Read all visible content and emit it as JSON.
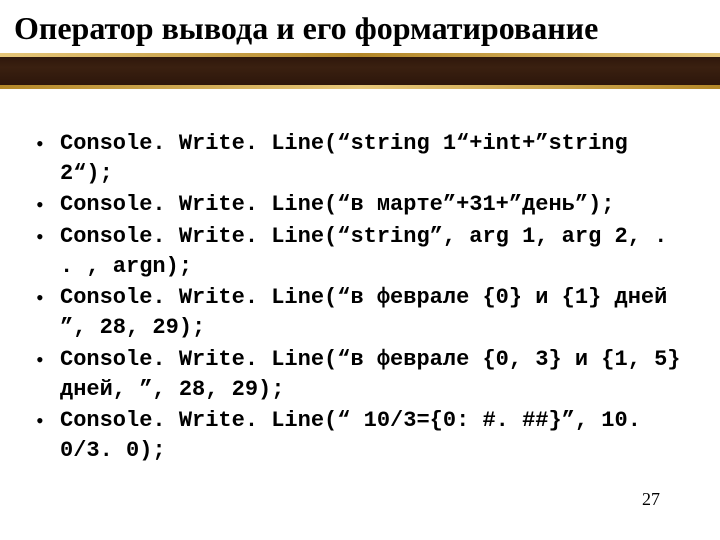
{
  "title": "Оператор вывода и его форматирование",
  "bullets": [
    "Console. Write. Line(“string 1“+int+”string 2“);",
    "Console. Write. Line(“в марте”+31+”день”);",
    "Console. Write. Line(“string”, arg 1, arg 2, . . , argn);",
    "Console. Write. Line(“в феврале {0} и {1} дней ”, 28, 29);",
    "Console. Write. Line(“в феврале {0, 3} и {1, 5} дней, ”, 28, 29);",
    "Console. Write. Line(“ 10/3={0: #. ##}”, 10. 0/3. 0);"
  ],
  "page_number": "27"
}
